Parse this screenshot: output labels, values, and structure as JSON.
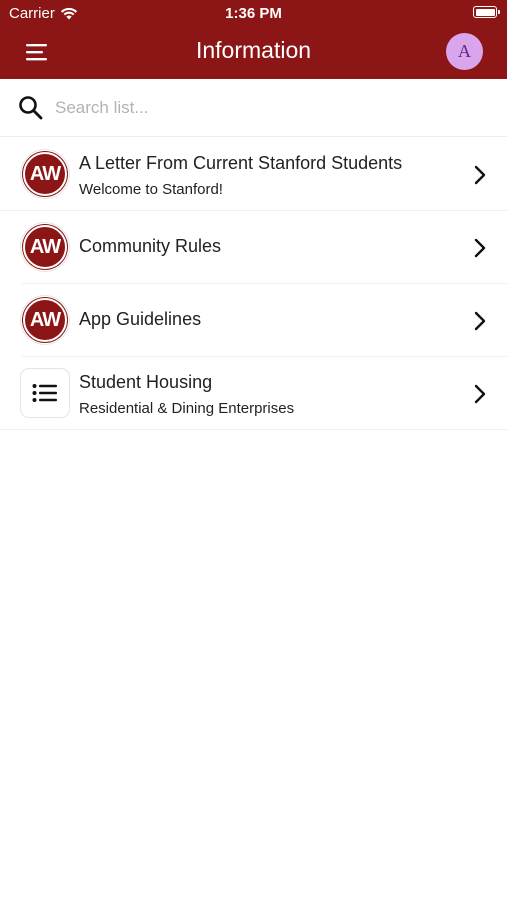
{
  "status_bar": {
    "carrier": "Carrier",
    "time": "1:36 PM"
  },
  "nav": {
    "title": "Information",
    "menu_icon": "hamburger-menu-icon",
    "avatar_letter": "A"
  },
  "search": {
    "placeholder": "Search list...",
    "value": ""
  },
  "list": {
    "items": [
      {
        "icon": "AW",
        "title": "A Letter From Current Stanford Students",
        "subtitle": "Welcome to Stanford!"
      },
      {
        "icon": "AW",
        "title": "Community Rules",
        "subtitle": ""
      },
      {
        "icon": "AW",
        "title": "App Guidelines",
        "subtitle": ""
      },
      {
        "icon": "list-icon",
        "title": "Student Housing",
        "subtitle": "Residential & Dining Enterprises"
      }
    ]
  },
  "colors": {
    "brand": "#8c1515",
    "avatar_bg": "#d9a6ee",
    "text": "#222222",
    "placeholder": "#b3b3b3"
  }
}
